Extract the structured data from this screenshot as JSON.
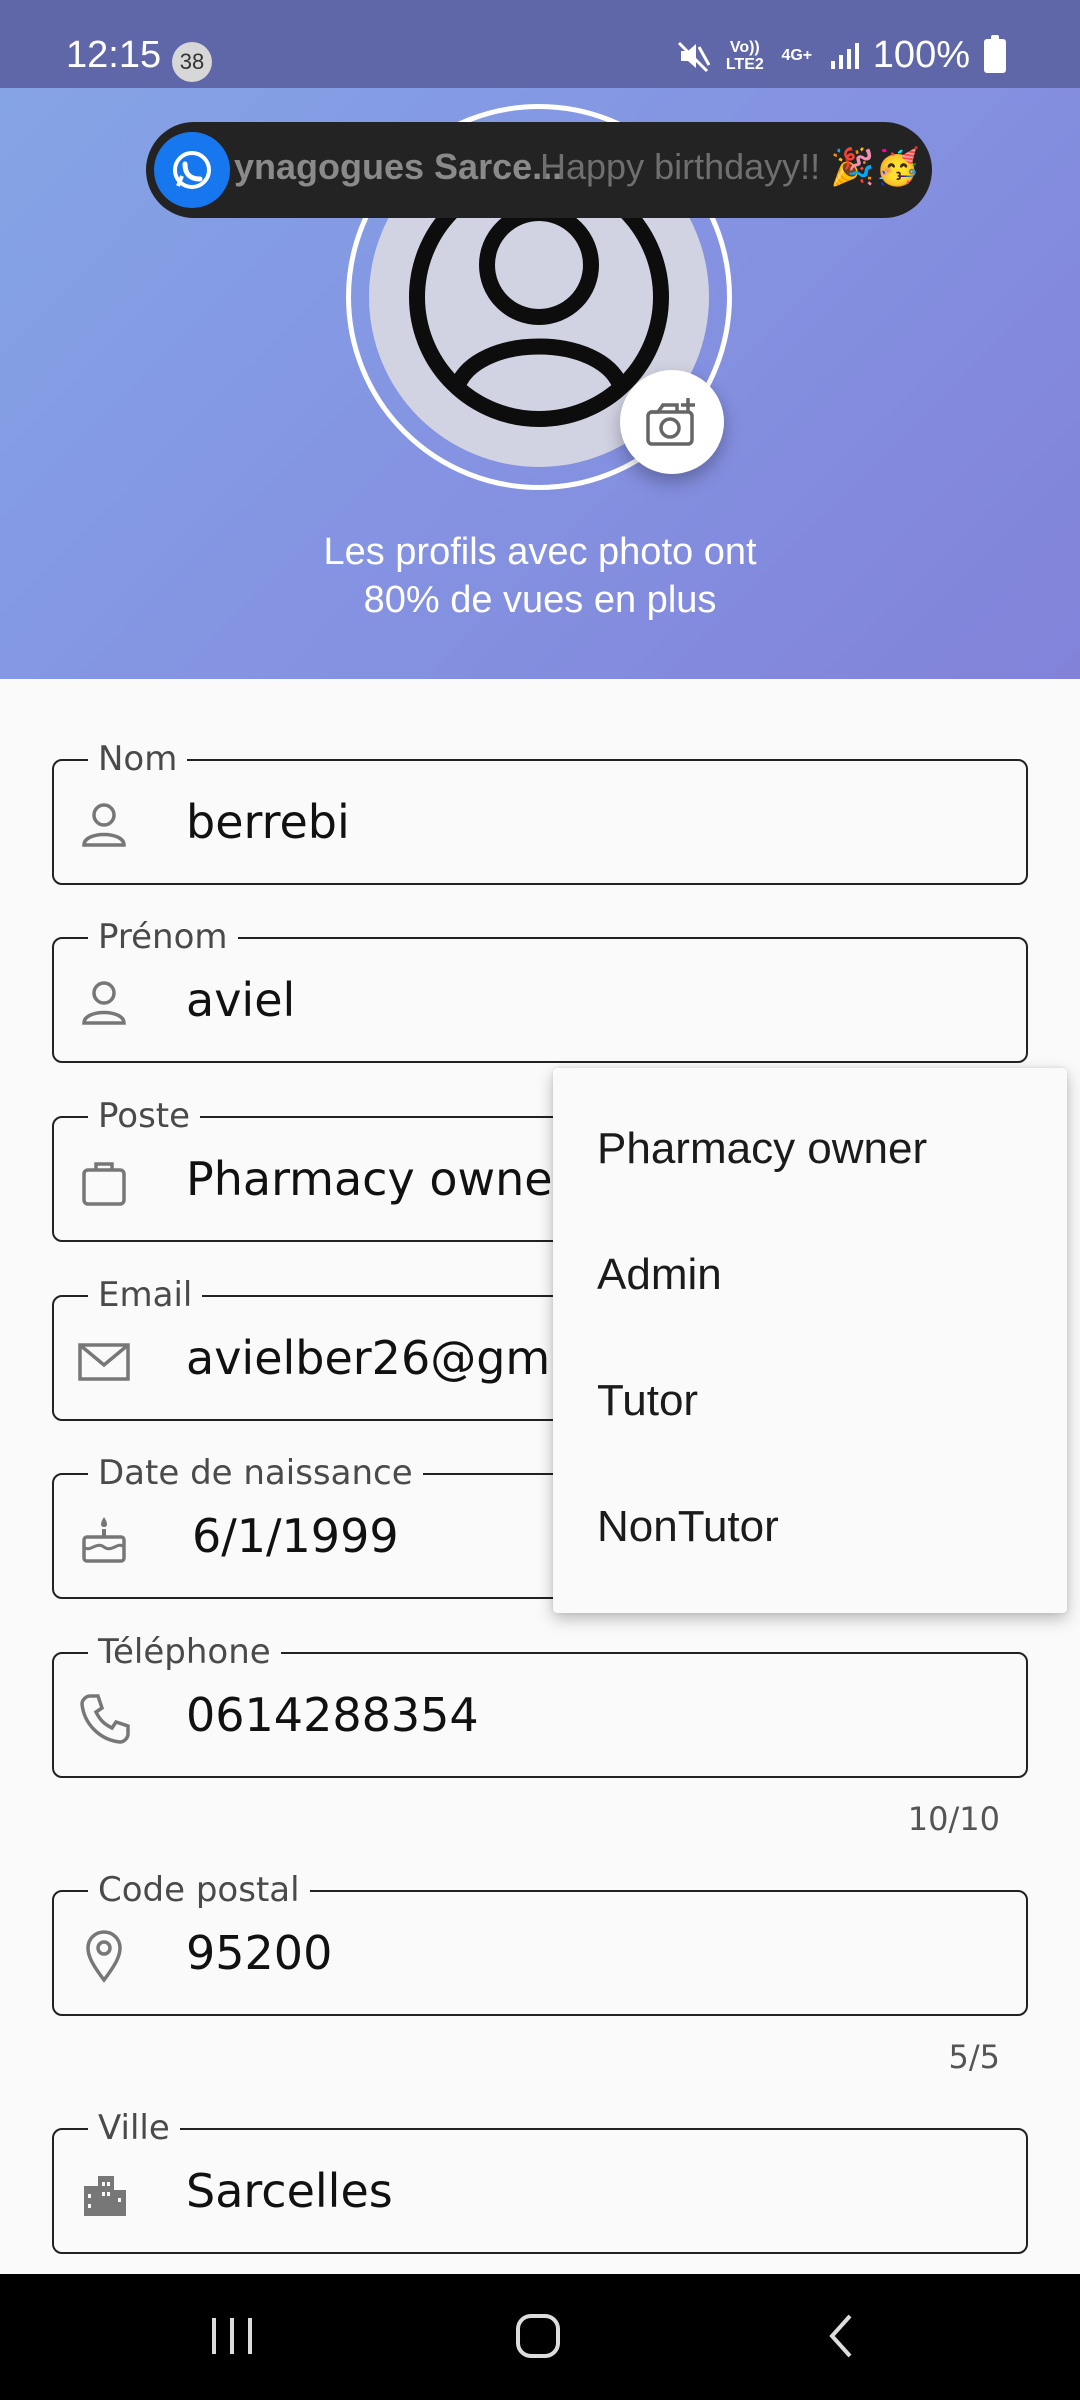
{
  "status_bar": {
    "time": "12:15",
    "notification_count": "38",
    "volte_label": "Vo)) LTE2",
    "network_label": "4G+",
    "battery": "100%"
  },
  "notification": {
    "title": "ynagogues Sarce...",
    "message": "Happy birthdayy!! 🎉🥳"
  },
  "profile": {
    "photo_caption_line1": "Les profils avec photo ont",
    "photo_caption_line2": "80% de vues en plus"
  },
  "fields": {
    "nom": {
      "label": "Nom",
      "value": "berrebi"
    },
    "prenom": {
      "label": "Prénom",
      "value": "aviel"
    },
    "poste": {
      "label": "Poste",
      "value": "Pharmacy owne"
    },
    "email": {
      "label": "Email",
      "value": "avielber26@gm"
    },
    "naissance": {
      "label": "Date de naissance",
      "value": "6/1/1999"
    },
    "telephone": {
      "label": "Téléphone",
      "value": "0614288354",
      "counter": "10/10"
    },
    "code_postal": {
      "label": "Code postal",
      "value": "95200",
      "counter": "5/5"
    },
    "ville": {
      "label": "Ville",
      "value": "Sarcelles"
    }
  },
  "dropdown": {
    "options": [
      "Pharmacy owner",
      "Admin",
      "Tutor",
      "NonTutor"
    ]
  },
  "colors": {
    "hero_start": "#85a6e6",
    "hero_end": "#8282d9",
    "notification_icon": "#1677ee"
  }
}
